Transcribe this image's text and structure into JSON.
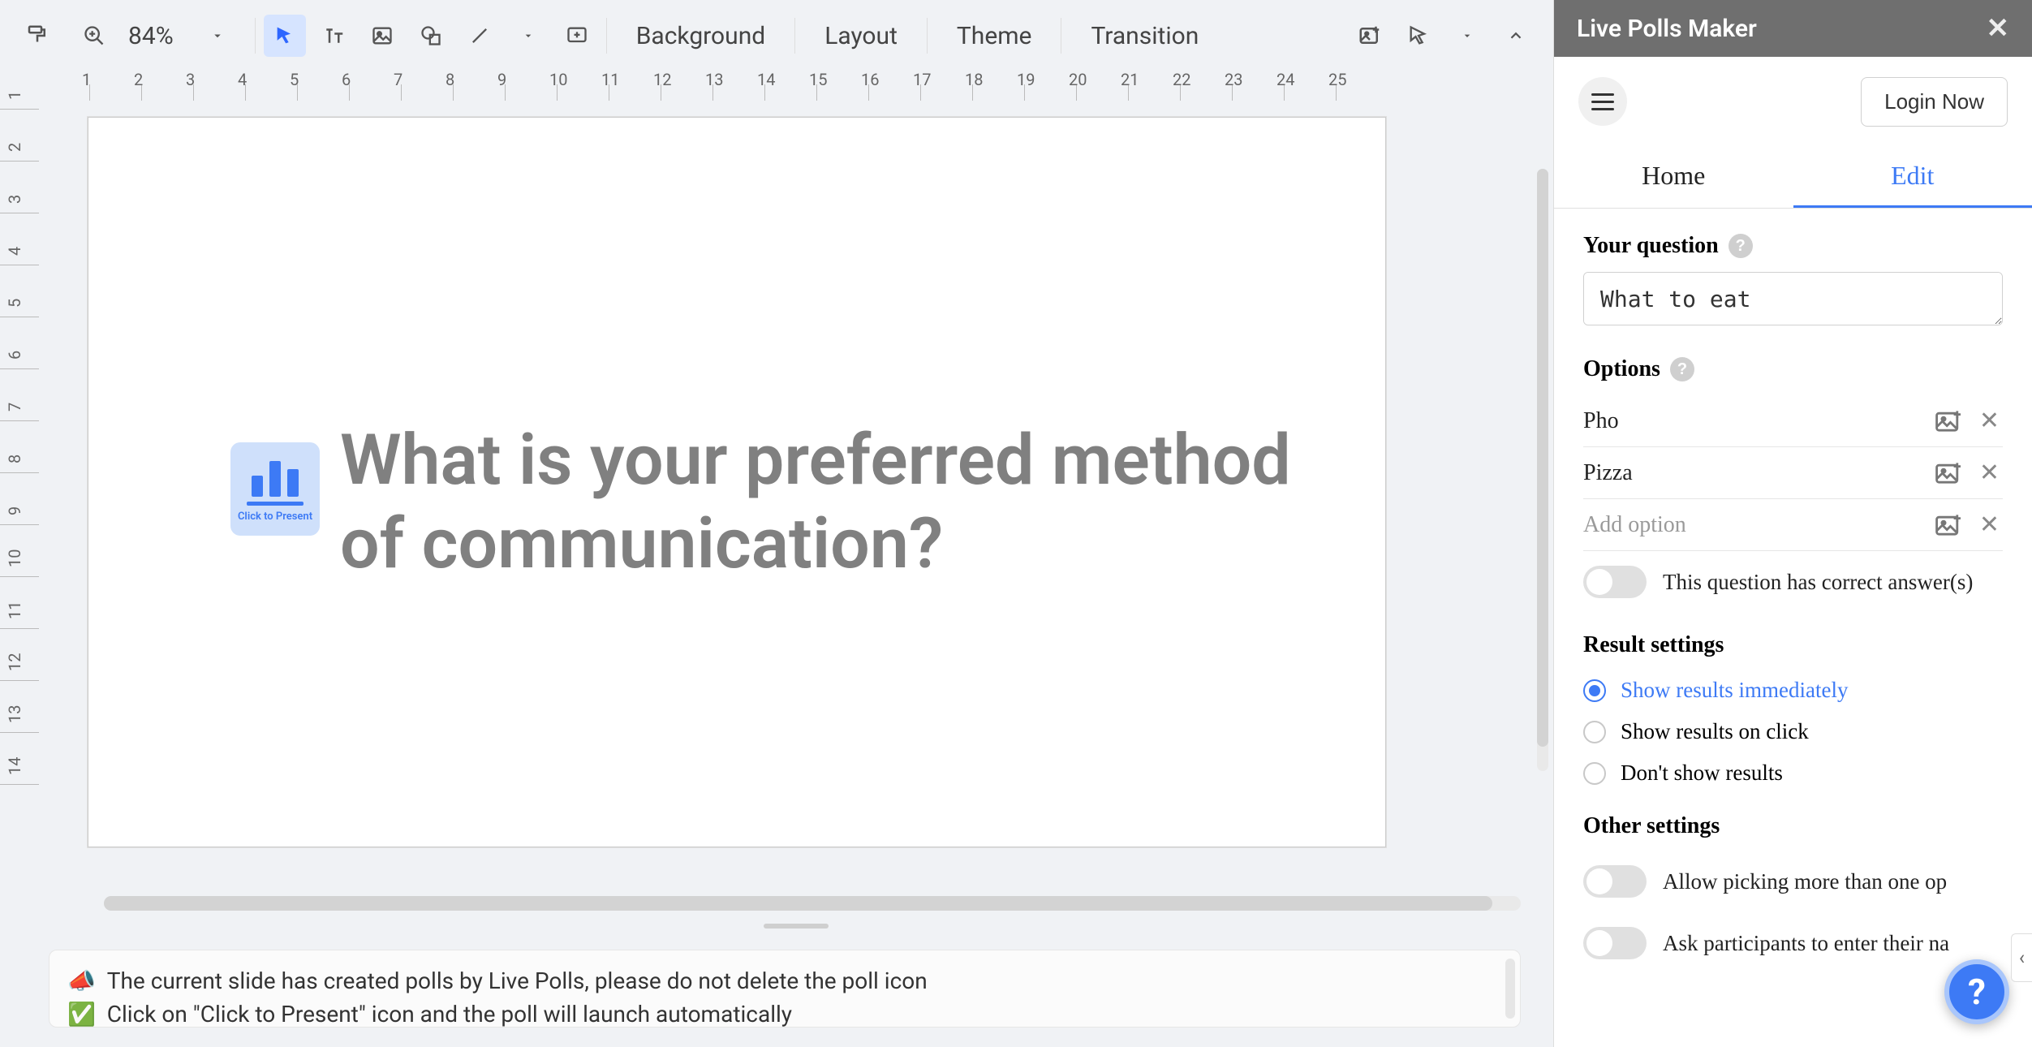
{
  "toolbar": {
    "zoom": "84%",
    "menus": [
      "Background",
      "Layout",
      "Theme",
      "Transition"
    ]
  },
  "ruler_h": [
    1,
    2,
    3,
    4,
    5,
    6,
    7,
    8,
    9,
    10,
    11,
    12,
    13,
    14,
    15,
    16,
    17,
    18,
    19,
    20,
    21,
    22,
    23,
    24,
    25
  ],
  "ruler_v": [
    1,
    2,
    3,
    4,
    5,
    6,
    7,
    8,
    9,
    10,
    11,
    12,
    13,
    14
  ],
  "slide": {
    "poll_badge_label": "Click to Present",
    "title": "What is your preferred method of communication?"
  },
  "notes": {
    "line1_icon": "📣",
    "line1": "The current slide has created polls by Live Polls, please do not delete the poll icon",
    "line2_icon": "✅",
    "line2": "Click on \"Click to Present\" icon and the poll will launch automatically"
  },
  "sidebar": {
    "title": "Live Polls Maker",
    "login": "Login Now",
    "tabs": {
      "home": "Home",
      "edit": "Edit"
    },
    "question_label": "Your question",
    "question_value": "What to eat",
    "options_label": "Options",
    "options": [
      "Pho",
      "Pizza"
    ],
    "add_option_placeholder": "Add option",
    "correct_answer_label": "This question has correct answer(s)",
    "result_settings_label": "Result settings",
    "result_options": {
      "immediately": "Show results immediately",
      "on_click": "Show results on click",
      "dont_show": "Don't show results"
    },
    "other_settings_label": "Other settings",
    "other_options": {
      "multi_pick": "Allow picking more than one op",
      "enter_name": "Ask participants to enter their na"
    }
  }
}
